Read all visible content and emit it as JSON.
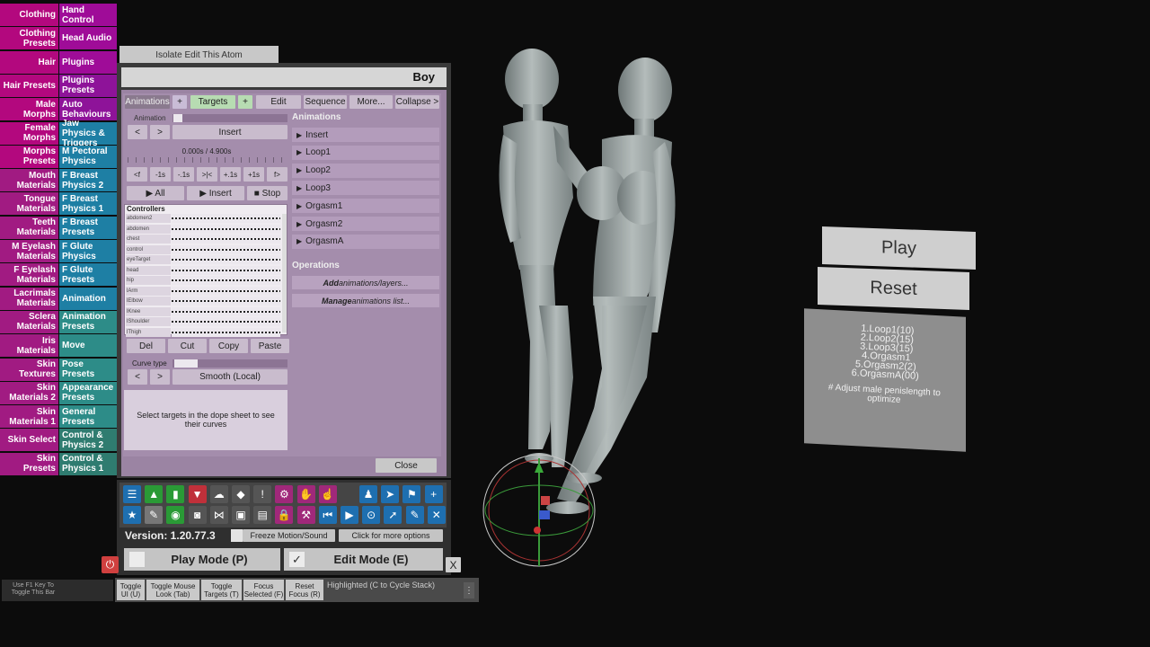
{
  "tabs_left": [
    "Clothing",
    "Clothing Presets",
    "Hair",
    "Hair Presets",
    "Male Morphs",
    "Female Morphs",
    "Morphs Presets",
    "Mouth Materials",
    "Tongue Materials",
    "Teeth Materials",
    "M Eyelash Materials",
    "F Eyelash Materials",
    "Lacrimals Materials",
    "Sclera Materials",
    "Iris Materials",
    "Skin Textures",
    "Skin Materials 2",
    "Skin Materials 1",
    "Skin Select",
    "Skin Presets"
  ],
  "tabs_right": [
    "Hand Control",
    "Head Audio",
    "Plugins",
    "Plugins Presets",
    "Auto Behaviours",
    "Jaw Physics & Triggers",
    "M Pectoral Physics",
    "F Breast Physics 2",
    "F Breast Physics 1",
    "F Breast Presets",
    "F Glute Physics",
    "F Glute Presets",
    "Animation",
    "Animation Presets",
    "Move",
    "Pose Presets",
    "Appearance Presets",
    "General Presets",
    "Control & Physics 2",
    "Control & Physics 1"
  ],
  "isolate_button": "Isolate Edit This Atom",
  "panel": {
    "title": "Boy",
    "tabs": [
      "Animations",
      "+",
      "Targets",
      "+",
      "Edit",
      "Sequence",
      "More...",
      "Collapse >"
    ],
    "animation_label": "Animation",
    "prev": "<",
    "next": ">",
    "insert": "Insert",
    "time": "0.000s / 4.900s",
    "scrub_buttons": [
      "<f",
      "-1s",
      "-.1s",
      ">|<",
      "+.1s",
      "+1s",
      "f>"
    ],
    "play_all": "▶ All",
    "play_insert": "▶ Insert",
    "stop": "■ Stop",
    "controllers_title": "Controllers",
    "controllers": [
      "abdomen2",
      "abdomen",
      "chest",
      "control",
      "eyeTarget",
      "head",
      "hip",
      "lArm",
      "lElbow",
      "lKnee",
      "lShoulder",
      "lThigh"
    ],
    "edit_buttons": [
      "Del",
      "Cut",
      "Copy",
      "Paste"
    ],
    "curve_type_label": "Curve type",
    "curve_value": "Smooth (Local)",
    "hint": "Select targets in the dope sheet to see their curves",
    "animations_title": "Animations",
    "animations": [
      "Insert",
      "Loop1",
      "Loop2",
      "Loop3",
      "Orgasm1",
      "Orgasm2",
      "OrgasmA"
    ],
    "operations_title": "Operations",
    "ops": [
      {
        "em": "Add",
        "rest": " animations/layers..."
      },
      {
        "em": "Manage",
        "rest": " animations list..."
      }
    ],
    "close": "Close"
  },
  "toolbar_icons": [
    "menu-icon",
    "folder-save-icon",
    "folder-open-icon",
    "save-red-icon",
    "cloud-download-icon",
    "cube-icon",
    "alert-icon",
    "person-settings-icon",
    "hand-icon",
    "hand-pointer-icon",
    "person-icon",
    "send-icon",
    "flag-icon",
    "plus-icon",
    "star-icon",
    "folder-edit-icon",
    "camera-green-icon",
    "camera-icon",
    "network-icon",
    "package-icon",
    "document-icon",
    "person-lock-icon",
    "hammer-icon",
    "skip-start-icon",
    "play-icon",
    "target-icon",
    "pointer-icon",
    "person-edit-icon",
    "tools-icon"
  ],
  "version": "Version: 1.20.77.3",
  "freeze": "Freeze Motion/Sound",
  "more_options": "Click for more options",
  "play_mode": "Play Mode (P)",
  "edit_mode": "Edit Mode (E)",
  "close_x": "X",
  "bottom_hint": "Use F1 Key To Toggle This Bar",
  "bottom_buttons": [
    "Toggle UI (U)",
    "Toggle Mouse Look (Tab)",
    "Toggle Targets (T)",
    "Focus Selected (F)",
    "Reset Focus (R)"
  ],
  "highlighted": "Highlighted (C to Cycle Stack)",
  "world_play": "Play",
  "world_reset": "Reset",
  "world_list": [
    "1.Loop1(10)",
    "2.Loop2(15)",
    "3.Loop3(15)",
    "4.Orgasm1",
    "5.Orgasm2(2)",
    "6.OrgasmA(00)"
  ],
  "world_note": "# Adjust male penislength to optimize"
}
